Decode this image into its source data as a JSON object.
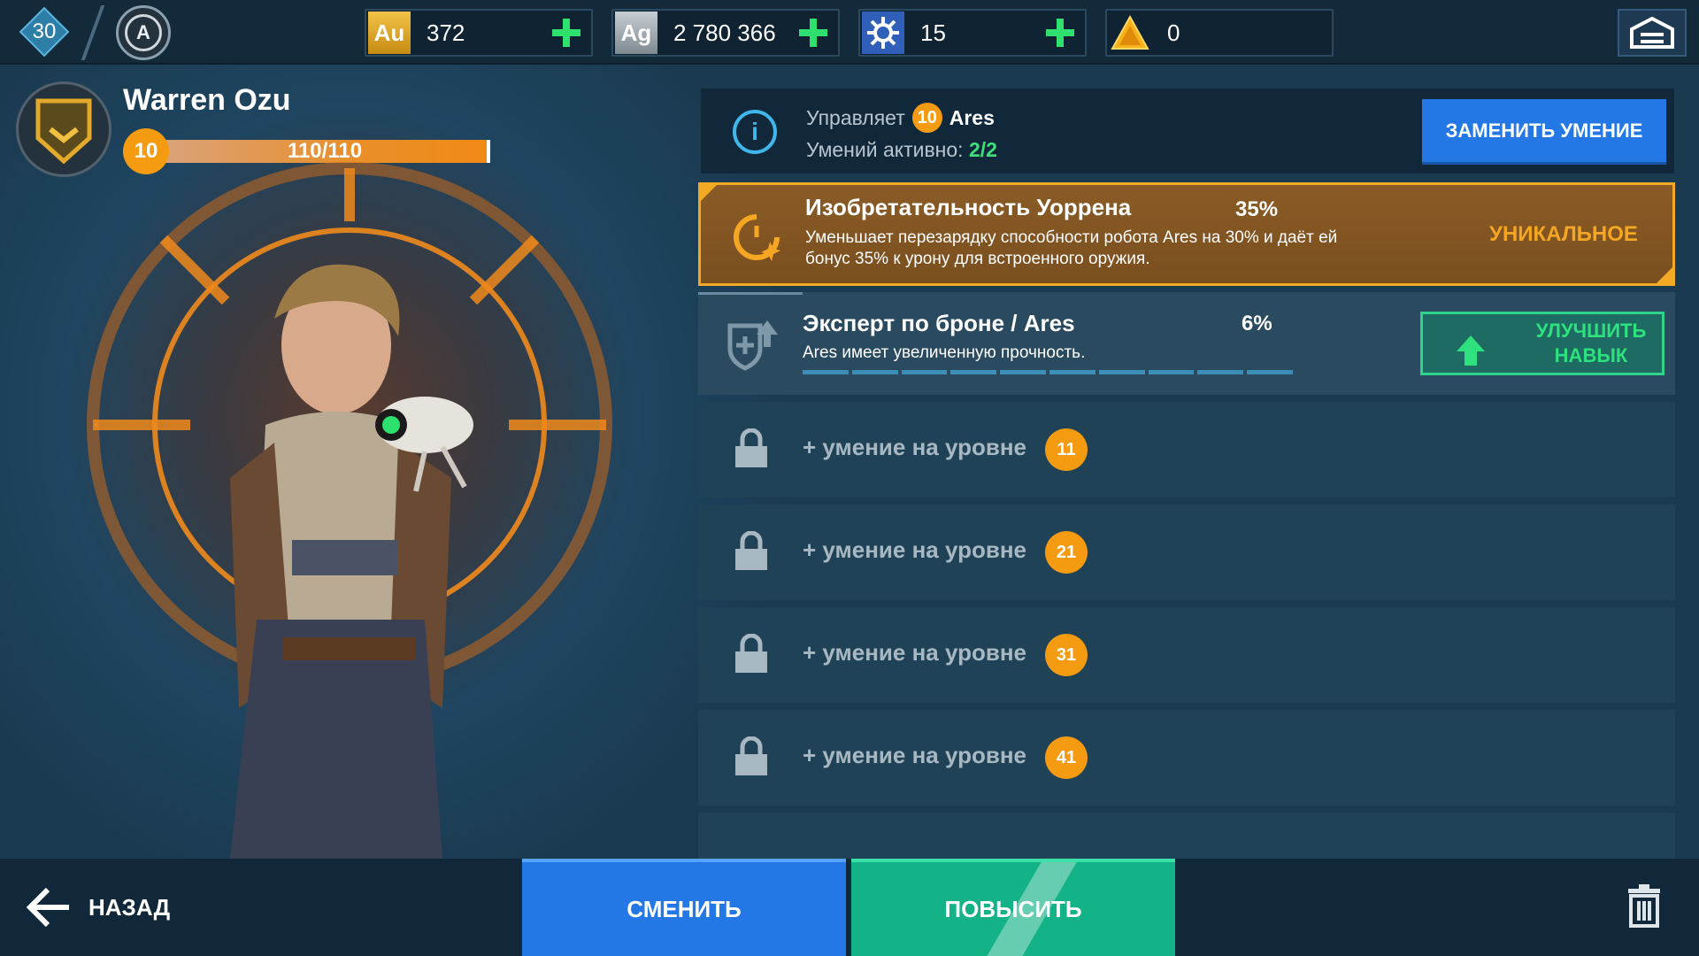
{
  "topbar": {
    "player_level": "30",
    "resources": [
      {
        "name": "gold",
        "chip": "Au",
        "value": "372"
      },
      {
        "name": "silver",
        "chip": "Ag",
        "value": "2 780 366"
      },
      {
        "name": "keys",
        "chip": "",
        "value": "15"
      },
      {
        "name": "tokens",
        "chip": "",
        "value": "0"
      }
    ]
  },
  "pilot": {
    "name": "Warren Ozu",
    "level": "10",
    "xp_text": "110/110",
    "xp_fraction": 1.0
  },
  "info": {
    "controls_label": "Управляет",
    "robot_level": "10",
    "robot_name": "Ares",
    "active_label": "Умений активно:",
    "active_value": "2/2",
    "replace_button": "ЗАМЕНИТЬ УМЕНИЕ"
  },
  "skills": {
    "unique": {
      "title": "Изобретательность Уоррена",
      "percent": "35%",
      "desc_line1": "Уменьшает перезарядку способности робота Ares на 30% и даёт ей",
      "desc_line2": "бонус 35% к урону для встроенного оружия.",
      "tag": "УНИКАЛЬНОЕ"
    },
    "armor": {
      "title": "Эксперт по броне / Ares",
      "percent": "6%",
      "desc": "Ares имеет увеличенную прочность.",
      "upgrade_line1": "УЛУЧШИТЬ",
      "upgrade_line2": "НАВЫК"
    },
    "locked": [
      {
        "text": "+ умение на уровне",
        "level": "11"
      },
      {
        "text": "+ умение на уровне",
        "level": "21"
      },
      {
        "text": "+ умение на уровне",
        "level": "31"
      },
      {
        "text": "+ умение на уровне",
        "level": "41"
      }
    ]
  },
  "bottom": {
    "back": "НАЗАД",
    "change": "СМЕНИТЬ",
    "promote": "ПОВЫСИТЬ"
  },
  "colors": {
    "accent_orange": "#f59b12",
    "accent_blue": "#2478e6",
    "accent_green": "#14b387"
  }
}
